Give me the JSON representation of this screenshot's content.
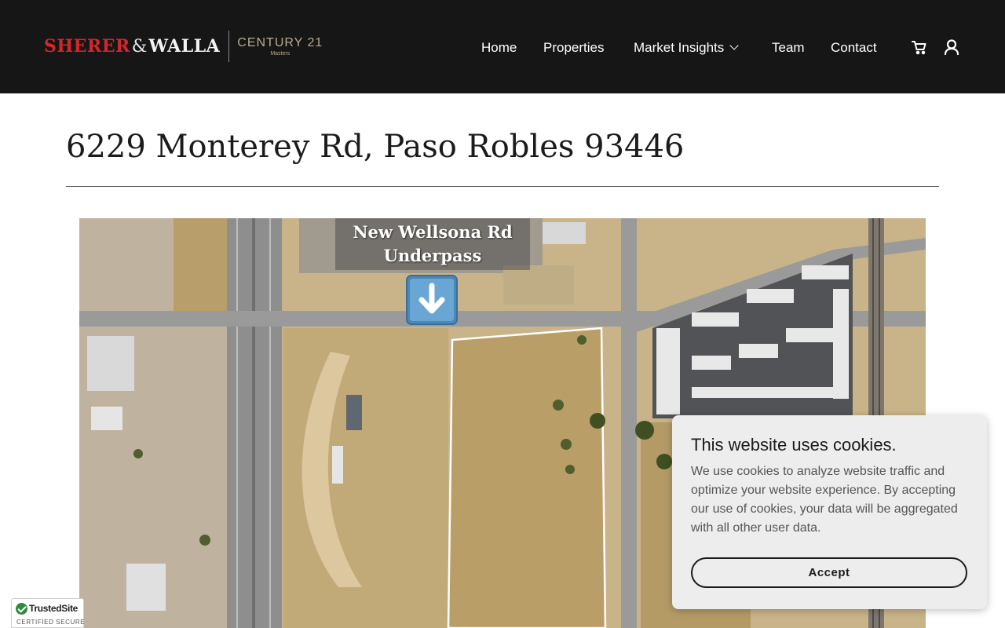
{
  "header": {
    "logo": {
      "sherer": "SHERER",
      "amp": "&",
      "walla": "WALLA",
      "brand": "CENTURY 21",
      "brand_sub": "Masters"
    },
    "nav": [
      {
        "label": "Home"
      },
      {
        "label": "Properties"
      },
      {
        "label": "Market Insights",
        "has_dropdown": true
      },
      {
        "label": "Team"
      },
      {
        "label": "Contact"
      }
    ],
    "icons": [
      "cart-icon",
      "account-icon"
    ]
  },
  "main": {
    "title": "6229 Monterey Rd, Paso Robles 93446",
    "image": {
      "overlay_line1": "New Wellsona Rd",
      "overlay_line2": "Underpass",
      "overlay_icon": "down-arrow-icon"
    }
  },
  "cookie_banner": {
    "title": "This website uses cookies.",
    "body": "We use cookies to analyze website traffic and optimize your website experience. By accepting our use of cookies, your data will be aggregated with all other user data.",
    "accept_label": "Accept"
  },
  "trusted_badge": {
    "name": "TrustedSite",
    "sub": "CERTIFIED SECURE"
  },
  "colors": {
    "header_bg": "#161616",
    "logo_red": "#d6262b",
    "brand_gold": "#b9ab90",
    "cookie_bg": "#ededed"
  }
}
